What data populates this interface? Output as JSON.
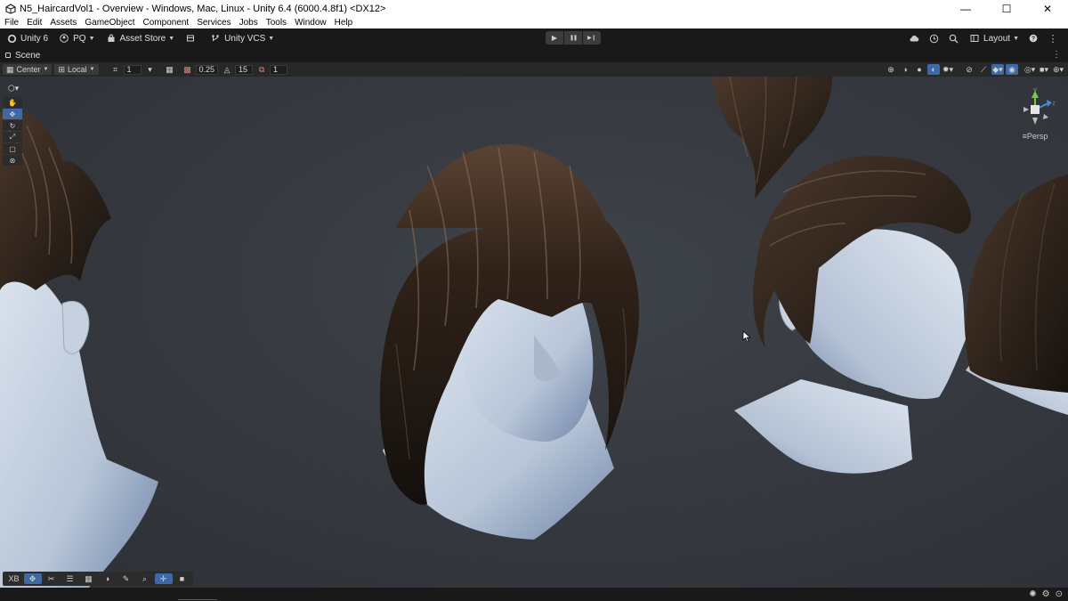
{
  "window": {
    "title": "N5_HaircardVol1 - Overview - Windows, Mac, Linux - Unity 6.4 (6000.4.8f1) <DX12>",
    "controls": {
      "minimize": "—",
      "maximize": "☐",
      "close": "✕"
    }
  },
  "menu": [
    "File",
    "Edit",
    "Assets",
    "GameObject",
    "Component",
    "Services",
    "Jobs",
    "Tools",
    "Window",
    "Help"
  ],
  "toolbar": {
    "unity_label": "Unity 6",
    "account_label": "PQ",
    "asset_store_label": "Asset Store",
    "vcs_label": "Unity VCS",
    "layout_label": "Layout",
    "play_icons": {
      "play": "▶",
      "pause": "❚❚",
      "step": "▶❙"
    }
  },
  "scene_tab": {
    "label": "Scene"
  },
  "scene_toolbar": {
    "pivot_label": "Center",
    "space_label": "Local",
    "snap_value_1": "1",
    "grid_value": "0.25",
    "rotate_snap": "15",
    "scale_snap": "1"
  },
  "gizmo": {
    "y_label": "y",
    "z_label": "z",
    "persp_label": "≡Persp"
  },
  "bottom_toolbar": {
    "xb_label": "XB"
  },
  "colors": {
    "accent": "#3d6aa5",
    "toolbar_bg": "#191919",
    "viewport_bg": "#383c42",
    "skin": "#c8d2e0",
    "hair": "#2b1d14"
  }
}
